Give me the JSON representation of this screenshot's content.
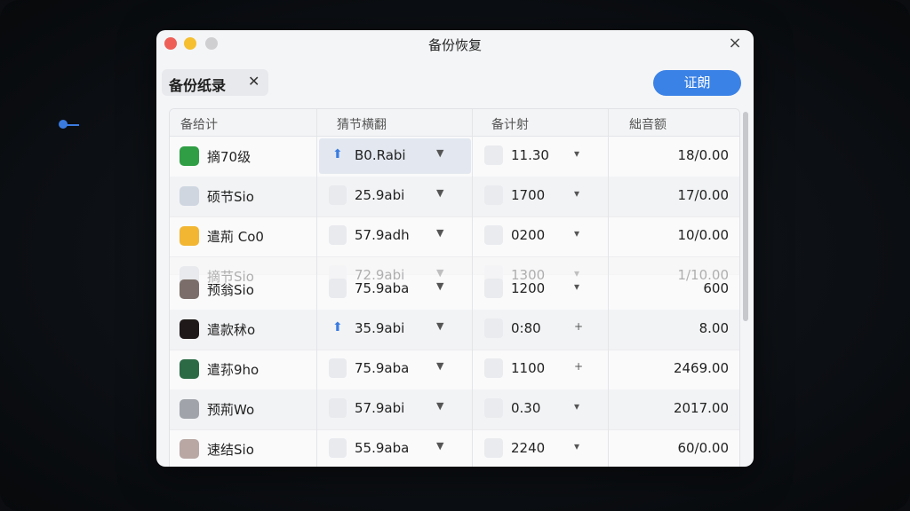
{
  "window": {
    "title": "备份恢复",
    "close_icon": "×"
  },
  "tab": {
    "label": "备份纸录",
    "close": "✕"
  },
  "primary_button": {
    "label": "证朗"
  },
  "table": {
    "headers": [
      "备给计",
      "猜节横翻",
      "备计射",
      "絀音额"
    ],
    "rows": [
      {
        "name": "摘70级",
        "size": "B0.Rabi",
        "time": "11.30",
        "amount": "18/0.00",
        "icon_color": "#2f9e44",
        "has_arrow": true,
        "highlight": true,
        "ctrl": "▾"
      },
      {
        "name": "硕节Sio",
        "size": "25.9abi",
        "time": "1700",
        "amount": "17/0.00",
        "icon_color": "#cfd6e0",
        "has_arrow": false,
        "highlight": false,
        "ctrl": "▾"
      },
      {
        "name": "遣荊 Co0",
        "size": "57.9adh",
        "time": "0200",
        "amount": "10/0.00",
        "icon_color": "#f2b632",
        "has_arrow": false,
        "highlight": false,
        "ctrl": "▾"
      },
      {
        "name": "摘节Sio",
        "size": "72.9abi",
        "time": "1300",
        "amount": "1/10.00",
        "icon_color": "#c9ced6",
        "has_arrow": false,
        "highlight": false,
        "ctrl": "▾",
        "ghost": true
      },
      {
        "name": "预翁Sio",
        "size": "75.9aba",
        "time": "1200",
        "amount": "600",
        "icon_color": "#7b6e6a",
        "has_arrow": false,
        "highlight": false,
        "ctrl": "▾"
      },
      {
        "name": "遣款秫o",
        "size": "35.9abi",
        "time": "0:80",
        "amount": "8.00",
        "icon_color": "#1f1a19",
        "has_arrow": true,
        "highlight": false,
        "ctrl": "+"
      },
      {
        "name": "遣荪9ho",
        "size": "75.9aba",
        "time": "1100",
        "amount": "2469.00",
        "icon_color": "#2c6a46",
        "has_arrow": false,
        "highlight": false,
        "ctrl": "+"
      },
      {
        "name": "预荊Wo",
        "size": "57.9abi",
        "time": "0.30",
        "amount": "2017.00",
        "icon_color": "#a0a4aa",
        "has_arrow": false,
        "highlight": false,
        "ctrl": "▾"
      },
      {
        "name": "速结Sio",
        "size": "55.9aba",
        "time": "2240",
        "amount": "60/0.00",
        "icon_color": "#b8a7a3",
        "has_arrow": false,
        "highlight": false,
        "ctrl": "▾"
      }
    ]
  }
}
